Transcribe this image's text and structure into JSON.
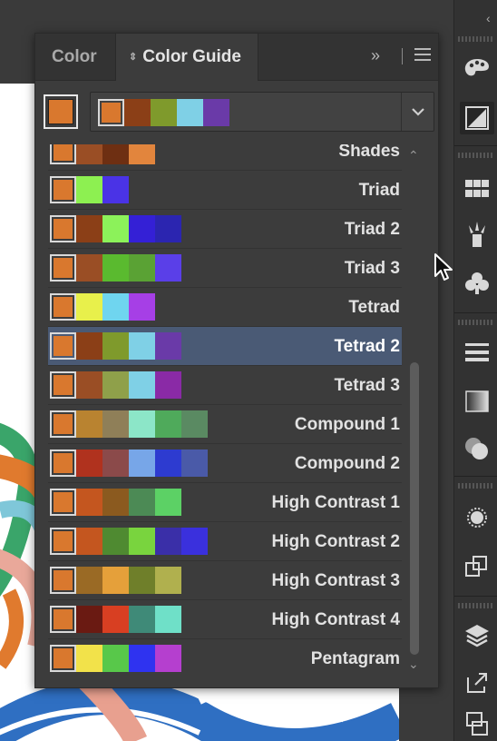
{
  "tabs": [
    {
      "label": "Color",
      "active": false
    },
    {
      "label": "Color Guide",
      "active": true
    }
  ],
  "panel_menu": {
    "expand_glyph": "»",
    "menu_icon": "hamburger-icon"
  },
  "current_color": "#d9782e",
  "active_group": [
    "#d9782e",
    "#8b3f17",
    "#7f9a2c",
    "#7fd0e6",
    "#6a3aa8"
  ],
  "harmony_rules": [
    {
      "label": "Shades",
      "colors": [
        "#d9782e",
        "#9a4e25",
        "#6e2f12",
        "#e2853d"
      ],
      "selected": false
    },
    {
      "label": "Triad",
      "colors": [
        "#d9782e",
        "#8df051",
        "#4a33e6"
      ],
      "selected": false
    },
    {
      "label": "Triad 2",
      "colors": [
        "#d9782e",
        "#8b3f17",
        "#8cf25a",
        "#3420d6",
        "#2b25b0"
      ],
      "selected": false
    },
    {
      "label": "Triad 3",
      "colors": [
        "#d9782e",
        "#9a4e25",
        "#5aba2f",
        "#5aa234",
        "#5a3fe8"
      ],
      "selected": false
    },
    {
      "label": "Tetrad",
      "colors": [
        "#d9782e",
        "#e8f04b",
        "#6fd5ef",
        "#a63fe6"
      ],
      "selected": false
    },
    {
      "label": "Tetrad 2",
      "colors": [
        "#d9782e",
        "#8b3f17",
        "#7f9a2c",
        "#7fd0e6",
        "#6a3aa8"
      ],
      "selected": true
    },
    {
      "label": "Tetrad 3",
      "colors": [
        "#d9782e",
        "#9a4e25",
        "#8fa04a",
        "#7fd0e6",
        "#8a2aa6"
      ],
      "selected": false
    },
    {
      "label": "Compound 1",
      "colors": [
        "#d9782e",
        "#b98330",
        "#8f7f58",
        "#8ce6c8",
        "#4faa5b",
        "#5a8a62"
      ],
      "selected": false
    },
    {
      "label": "Compound 2",
      "colors": [
        "#d9782e",
        "#b0321e",
        "#8b4a4a",
        "#77a6e8",
        "#2d3bd0",
        "#4a5aa8"
      ],
      "selected": false
    },
    {
      "label": "High Contrast 1",
      "colors": [
        "#d9782e",
        "#c4561f",
        "#8b5a1f",
        "#4c8a55",
        "#5cd165"
      ],
      "selected": false
    },
    {
      "label": "High Contrast 2",
      "colors": [
        "#d9782e",
        "#c4561f",
        "#4f8a31",
        "#79d43e",
        "#3a2fa8",
        "#3a30dd"
      ],
      "selected": false
    },
    {
      "label": "High Contrast 3",
      "colors": [
        "#d9782e",
        "#9a6a25",
        "#e5a03a",
        "#6f7f2a",
        "#b0b04e"
      ],
      "selected": false
    },
    {
      "label": "High Contrast 4",
      "colors": [
        "#d9782e",
        "#6a1a12",
        "#d83f22",
        "#3f8a78",
        "#6fe0c8"
      ],
      "selected": false
    },
    {
      "label": "Pentagram",
      "colors": [
        "#d9782e",
        "#f2e24a",
        "#58c84a",
        "#2f33f0",
        "#b53fcf"
      ],
      "selected": false
    }
  ],
  "tool_icons": [
    "palette-icon",
    "color-guide-icon",
    "swatches-icon",
    "brushes-icon",
    "symbols-icon",
    "stroke-icon",
    "gradient-icon",
    "transparency-icon",
    "appearance-icon",
    "graphic-styles-icon",
    "layers-icon",
    "export-icon",
    "artboards-icon"
  ]
}
